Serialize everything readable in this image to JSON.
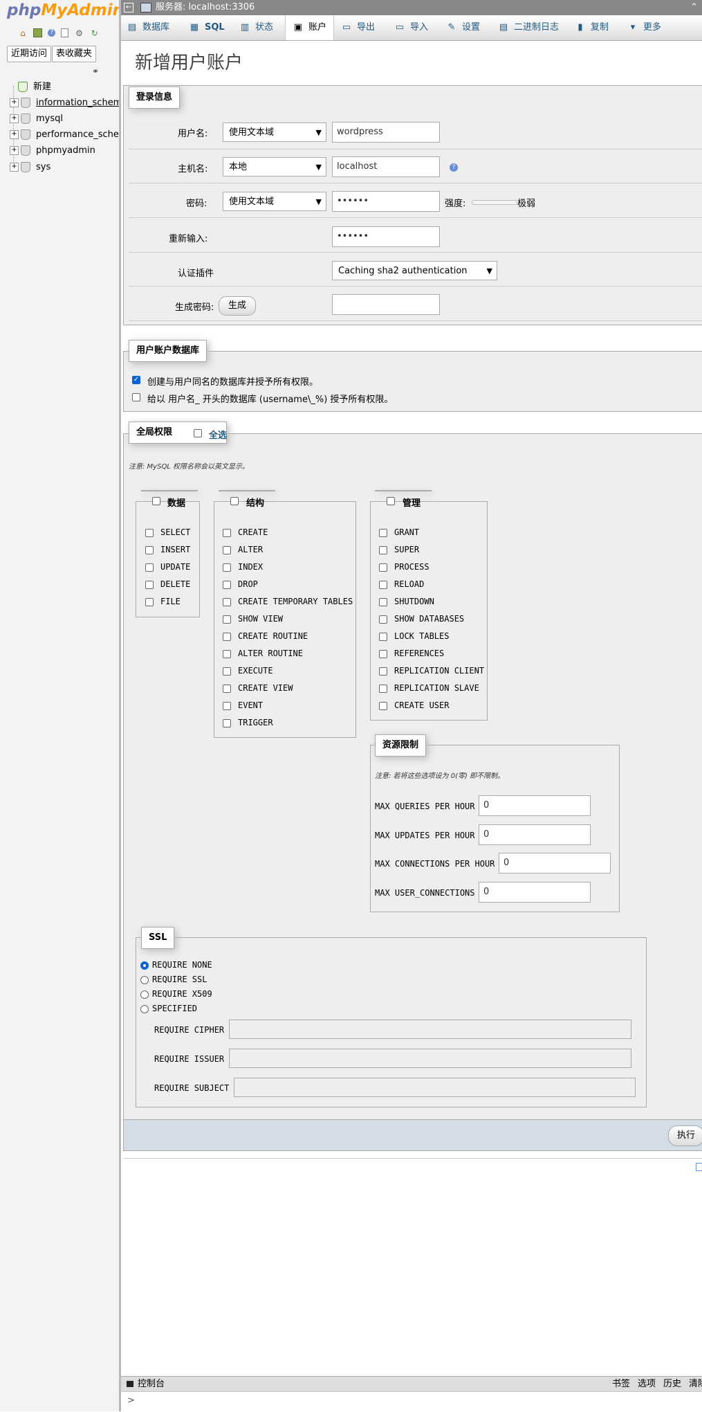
{
  "nav": {
    "logo_php": "php",
    "logo_my": "My",
    "logo_admin": "Admin",
    "icons": [
      "home-icon",
      "database-icon",
      "help-icon",
      "document-icon",
      "settings-icon",
      "reload-icon"
    ],
    "recent_label": "近期访问",
    "favorites_label": "表收藏夹",
    "tree": [
      {
        "name": "新建",
        "type": "new"
      },
      {
        "name": "information_schema",
        "type": "db"
      },
      {
        "name": "mysql",
        "type": "db"
      },
      {
        "name": "performance_schema",
        "type": "db"
      },
      {
        "name": "phpmyadmin",
        "type": "db"
      },
      {
        "name": "sys",
        "type": "db"
      }
    ]
  },
  "serverbar": {
    "label": "服务器: localhost:3306"
  },
  "tabs": [
    {
      "label": "数据库",
      "icon": "database-icon"
    },
    {
      "label": "SQL",
      "icon": "sql-icon"
    },
    {
      "label": "状态",
      "icon": "status-icon"
    },
    {
      "label": "账户",
      "icon": "users-icon"
    },
    {
      "label": "导出",
      "icon": "export-icon"
    },
    {
      "label": "导入",
      "icon": "import-icon"
    },
    {
      "label": "设置",
      "icon": "wrench-icon"
    },
    {
      "label": "二进制日志",
      "icon": "binlog-icon"
    },
    {
      "label": "复制",
      "icon": "replication-icon"
    },
    {
      "label": "更多",
      "icon": "chevron-down-icon"
    }
  ],
  "page_title": "新增用户账户",
  "login": {
    "legend": "登录信息",
    "username_label": "用户名:",
    "username_type": "使用文本域",
    "username_value": "wordpress",
    "host_label": "主机名:",
    "host_type": "本地",
    "host_value": "localhost",
    "password_label": "密码:",
    "password_type": "使用文本域",
    "password_value": "••••••",
    "strength_label": "强度:",
    "strength_value": "极弱",
    "retype_label": "重新输入:",
    "retype_value": "••••••",
    "auth_label": "认证插件",
    "auth_value": "Caching sha2 authentication",
    "generate_label": "生成密码:",
    "generate_button": "生成",
    "generate_value": ""
  },
  "userdb": {
    "legend": "用户账户数据库",
    "option1": "创建与用户同名的数据库并授予所有权限。",
    "option1_checked": true,
    "option2": "给以 用户名_ 开头的数据库 (username\\_%) 授予所有权限。",
    "option2_checked": false
  },
  "global": {
    "legend": "全局权限",
    "select_all": "全选",
    "note": "注意: MySQL 权限名称会以英文显示。",
    "data": {
      "legend": "数据",
      "items": [
        "SELECT",
        "INSERT",
        "UPDATE",
        "DELETE",
        "FILE"
      ]
    },
    "structure": {
      "legend": "结构",
      "items": [
        "CREATE",
        "ALTER",
        "INDEX",
        "DROP",
        "CREATE TEMPORARY TABLES",
        "SHOW VIEW",
        "CREATE ROUTINE",
        "ALTER ROUTINE",
        "EXECUTE",
        "CREATE VIEW",
        "EVENT",
        "TRIGGER"
      ]
    },
    "admin": {
      "legend": "管理",
      "items": [
        "GRANT",
        "SUPER",
        "PROCESS",
        "RELOAD",
        "SHUTDOWN",
        "SHOW DATABASES",
        "LOCK TABLES",
        "REFERENCES",
        "REPLICATION CLIENT",
        "REPLICATION SLAVE",
        "CREATE USER"
      ]
    },
    "resources": {
      "legend": "资源限制",
      "note": "注意: 若将这些选项设为 0(零) 即不限制。",
      "items": [
        {
          "label": "MAX QUERIES PER HOUR",
          "value": "0"
        },
        {
          "label": "MAX UPDATES PER HOUR",
          "value": "0"
        },
        {
          "label": "MAX CONNECTIONS PER HOUR",
          "value": "0"
        },
        {
          "label": "MAX USER_CONNECTIONS",
          "value": "0"
        }
      ]
    }
  },
  "ssl": {
    "legend": "SSL",
    "options": [
      "REQUIRE NONE",
      "REQUIRE SSL",
      "REQUIRE X509",
      "SPECIFIED"
    ],
    "selected": "REQUIRE NONE",
    "fields": [
      "REQUIRE CIPHER",
      "REQUIRE ISSUER",
      "REQUIRE SUBJECT"
    ]
  },
  "submit_label": "执行",
  "console": {
    "label": "控制台",
    "right_items": [
      "书签",
      "选项",
      "历史",
      "清除"
    ],
    "prompt": ">"
  }
}
